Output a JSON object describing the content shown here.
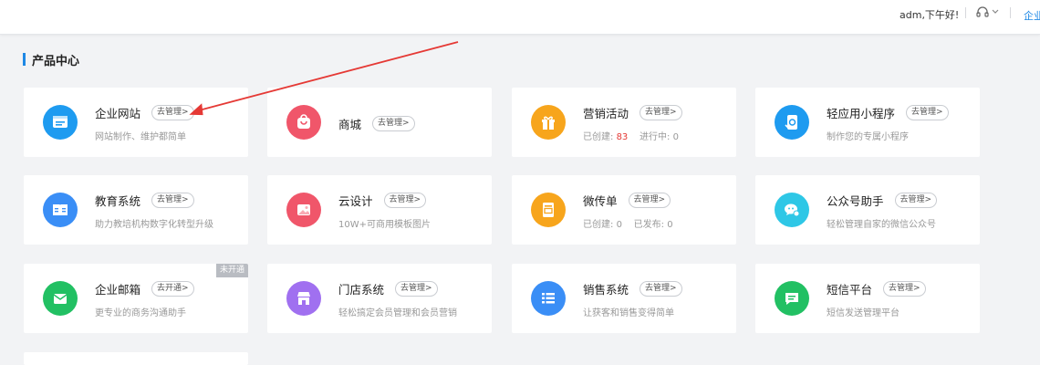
{
  "topbar": {
    "greeting": "adm,下午好!",
    "company_link": "企业"
  },
  "section": {
    "title": "产品中心"
  },
  "cards": [
    {
      "name": "企业网站",
      "action": "去管理>",
      "desc": "网站制作、维护都简单",
      "icon": "website-icon",
      "color": "#1e9bf0"
    },
    {
      "name": "商城",
      "action": "去管理>",
      "desc": "",
      "icon": "shopping-bag-icon",
      "color": "#f0566a"
    },
    {
      "name": "营销活动",
      "action": "去管理>",
      "desc_parts": {
        "created_label": "已创建:",
        "created_value": "83",
        "ongoing_label": "进行中:",
        "ongoing_value": "0"
      },
      "icon": "gift-icon",
      "color": "#f7a51c"
    },
    {
      "name": "轻应用小程序",
      "action": "去管理>",
      "desc": "制作您的专属小程序",
      "icon": "mini-program-icon",
      "color": "#1e9bf0"
    },
    {
      "name": "教育系统",
      "action": "去管理>",
      "desc": "助力教培机构数字化转型升级",
      "icon": "book-icon",
      "color": "#3a8ef6"
    },
    {
      "name": "云设计",
      "action": "去管理>",
      "desc": "10W+可商用模板图片",
      "icon": "image-icon",
      "color": "#f0566a"
    },
    {
      "name": "微传单",
      "action": "去管理>",
      "desc_parts": {
        "created_label": "已创建:",
        "created_value": "0",
        "ongoing_label": "已发布:",
        "ongoing_value": "0"
      },
      "icon": "flyer-icon",
      "color": "#f7a51c"
    },
    {
      "name": "公众号助手",
      "action": "去管理>",
      "desc": "轻松管理自家的微信公众号",
      "icon": "wechat-icon",
      "color": "#2ec7e6"
    },
    {
      "name": "企业邮箱",
      "action": "去开通>",
      "desc": "更专业的商务沟通助手",
      "icon": "mail-icon",
      "color": "#22c063",
      "badge": "未开通"
    },
    {
      "name": "门店系统",
      "action": "去管理>",
      "desc": "轻松搞定会员管理和会员营销",
      "icon": "store-icon",
      "color": "#a070f0"
    },
    {
      "name": "销售系统",
      "action": "去管理>",
      "desc": "让获客和销售变得简单",
      "icon": "list-icon",
      "color": "#3a8ef6"
    },
    {
      "name": "短信平台",
      "action": "去管理>",
      "desc": "短信发送管理平台",
      "icon": "message-icon",
      "color": "#22c063"
    }
  ]
}
